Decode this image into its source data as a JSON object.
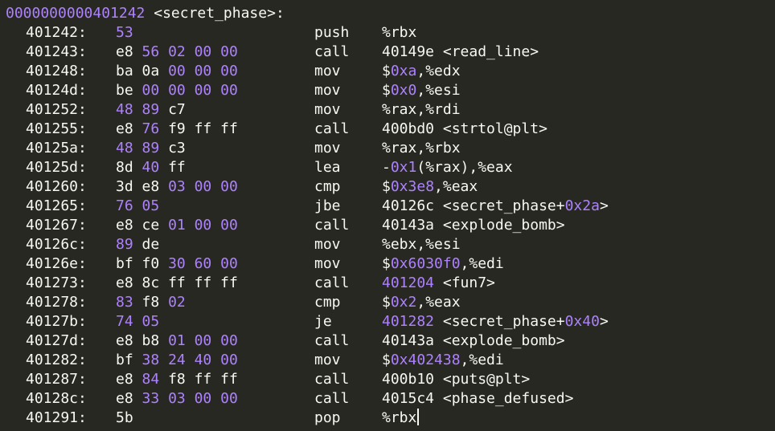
{
  "header": {
    "addr": "0000000000401242",
    "label": " <secret_phase>:"
  },
  "rows": [
    {
      "addr": "401242:",
      "bytes": [
        {
          "t": "53",
          "c": "p"
        }
      ],
      "mnem": "push",
      "ops": [
        {
          "t": "%rbx",
          "c": "w"
        }
      ]
    },
    {
      "addr": "401243:",
      "bytes": [
        {
          "t": "e8",
          "c": "w"
        },
        {
          "t": "56",
          "c": "p"
        },
        {
          "t": "02",
          "c": "p"
        },
        {
          "t": "00",
          "c": "p"
        },
        {
          "t": "00",
          "c": "p"
        }
      ],
      "mnem": "call",
      "ops": [
        {
          "t": "40149e <read_line>",
          "c": "w"
        }
      ]
    },
    {
      "addr": "401248:",
      "bytes": [
        {
          "t": "ba",
          "c": "w"
        },
        {
          "t": "0a",
          "c": "w"
        },
        {
          "t": "00",
          "c": "p"
        },
        {
          "t": "00",
          "c": "p"
        },
        {
          "t": "00",
          "c": "p"
        }
      ],
      "mnem": "mov",
      "ops": [
        {
          "t": "$",
          "c": "w"
        },
        {
          "t": "0xa",
          "c": "p"
        },
        {
          "t": ",%edx",
          "c": "w"
        }
      ]
    },
    {
      "addr": "40124d:",
      "bytes": [
        {
          "t": "be",
          "c": "w"
        },
        {
          "t": "00",
          "c": "p"
        },
        {
          "t": "00",
          "c": "p"
        },
        {
          "t": "00",
          "c": "p"
        },
        {
          "t": "00",
          "c": "p"
        }
      ],
      "mnem": "mov",
      "ops": [
        {
          "t": "$",
          "c": "w"
        },
        {
          "t": "0x0",
          "c": "p"
        },
        {
          "t": ",%esi",
          "c": "w"
        }
      ]
    },
    {
      "addr": "401252:",
      "bytes": [
        {
          "t": "48",
          "c": "p"
        },
        {
          "t": "89",
          "c": "p"
        },
        {
          "t": "c7",
          "c": "w"
        }
      ],
      "mnem": "mov",
      "ops": [
        {
          "t": "%rax,%rdi",
          "c": "w"
        }
      ]
    },
    {
      "addr": "401255:",
      "bytes": [
        {
          "t": "e8",
          "c": "w"
        },
        {
          "t": "76",
          "c": "p"
        },
        {
          "t": "f9",
          "c": "w"
        },
        {
          "t": "ff",
          "c": "w"
        },
        {
          "t": "ff",
          "c": "w"
        }
      ],
      "mnem": "call",
      "ops": [
        {
          "t": "400bd0 <strtol@plt>",
          "c": "w"
        }
      ]
    },
    {
      "addr": "40125a:",
      "bytes": [
        {
          "t": "48",
          "c": "p"
        },
        {
          "t": "89",
          "c": "p"
        },
        {
          "t": "c3",
          "c": "w"
        }
      ],
      "mnem": "mov",
      "ops": [
        {
          "t": "%rax,%rbx",
          "c": "w"
        }
      ]
    },
    {
      "addr": "40125d:",
      "bytes": [
        {
          "t": "8d",
          "c": "w"
        },
        {
          "t": "40",
          "c": "p"
        },
        {
          "t": "ff",
          "c": "w"
        }
      ],
      "mnem": "lea",
      "ops": [
        {
          "t": "-",
          "c": "w"
        },
        {
          "t": "0x1",
          "c": "p"
        },
        {
          "t": "(%rax),%eax",
          "c": "w"
        }
      ]
    },
    {
      "addr": "401260:",
      "bytes": [
        {
          "t": "3d",
          "c": "w"
        },
        {
          "t": "e8",
          "c": "w"
        },
        {
          "t": "03",
          "c": "p"
        },
        {
          "t": "00",
          "c": "p"
        },
        {
          "t": "00",
          "c": "p"
        }
      ],
      "mnem": "cmp",
      "ops": [
        {
          "t": "$",
          "c": "w"
        },
        {
          "t": "0x3e8",
          "c": "p"
        },
        {
          "t": ",%eax",
          "c": "w"
        }
      ]
    },
    {
      "addr": "401265:",
      "bytes": [
        {
          "t": "76",
          "c": "p"
        },
        {
          "t": "05",
          "c": "p"
        }
      ],
      "mnem": "jbe",
      "ops": [
        {
          "t": "40126c <secret_phase+",
          "c": "w"
        },
        {
          "t": "0x2a",
          "c": "p"
        },
        {
          "t": ">",
          "c": "w"
        }
      ]
    },
    {
      "addr": "401267:",
      "bytes": [
        {
          "t": "e8",
          "c": "w"
        },
        {
          "t": "ce",
          "c": "w"
        },
        {
          "t": "01",
          "c": "p"
        },
        {
          "t": "00",
          "c": "p"
        },
        {
          "t": "00",
          "c": "p"
        }
      ],
      "mnem": "call",
      "ops": [
        {
          "t": "40143a <explode_bomb>",
          "c": "w"
        }
      ]
    },
    {
      "addr": "40126c:",
      "bytes": [
        {
          "t": "89",
          "c": "p"
        },
        {
          "t": "de",
          "c": "w"
        }
      ],
      "mnem": "mov",
      "ops": [
        {
          "t": "%ebx,%esi",
          "c": "w"
        }
      ]
    },
    {
      "addr": "40126e:",
      "bytes": [
        {
          "t": "bf",
          "c": "w"
        },
        {
          "t": "f0",
          "c": "w"
        },
        {
          "t": "30",
          "c": "p"
        },
        {
          "t": "60",
          "c": "p"
        },
        {
          "t": "00",
          "c": "p"
        }
      ],
      "mnem": "mov",
      "ops": [
        {
          "t": "$",
          "c": "w"
        },
        {
          "t": "0x6030f0",
          "c": "p"
        },
        {
          "t": ",%edi",
          "c": "w"
        }
      ]
    },
    {
      "addr": "401273:",
      "bytes": [
        {
          "t": "e8",
          "c": "w"
        },
        {
          "t": "8c",
          "c": "w"
        },
        {
          "t": "ff",
          "c": "w"
        },
        {
          "t": "ff",
          "c": "w"
        },
        {
          "t": "ff",
          "c": "w"
        }
      ],
      "mnem": "call",
      "ops": [
        {
          "t": "401204",
          "c": "p"
        },
        {
          "t": " <fun7>",
          "c": "w"
        }
      ]
    },
    {
      "addr": "401278:",
      "bytes": [
        {
          "t": "83",
          "c": "p"
        },
        {
          "t": "f8",
          "c": "w"
        },
        {
          "t": "02",
          "c": "p"
        }
      ],
      "mnem": "cmp",
      "ops": [
        {
          "t": "$",
          "c": "w"
        },
        {
          "t": "0x2",
          "c": "p"
        },
        {
          "t": ",%eax",
          "c": "w"
        }
      ]
    },
    {
      "addr": "40127b:",
      "bytes": [
        {
          "t": "74",
          "c": "p"
        },
        {
          "t": "05",
          "c": "p"
        }
      ],
      "mnem": "je",
      "ops": [
        {
          "t": "401282",
          "c": "p"
        },
        {
          "t": " <secret_phase+",
          "c": "w"
        },
        {
          "t": "0x40",
          "c": "p"
        },
        {
          "t": ">",
          "c": "w"
        }
      ]
    },
    {
      "addr": "40127d:",
      "bytes": [
        {
          "t": "e8",
          "c": "w"
        },
        {
          "t": "b8",
          "c": "w"
        },
        {
          "t": "01",
          "c": "p"
        },
        {
          "t": "00",
          "c": "p"
        },
        {
          "t": "00",
          "c": "p"
        }
      ],
      "mnem": "call",
      "ops": [
        {
          "t": "40143a <explode_bomb>",
          "c": "w"
        }
      ]
    },
    {
      "addr": "401282:",
      "bytes": [
        {
          "t": "bf",
          "c": "w"
        },
        {
          "t": "38",
          "c": "p"
        },
        {
          "t": "24",
          "c": "p"
        },
        {
          "t": "40",
          "c": "p"
        },
        {
          "t": "00",
          "c": "p"
        }
      ],
      "mnem": "mov",
      "ops": [
        {
          "t": "$",
          "c": "w"
        },
        {
          "t": "0x402438",
          "c": "p"
        },
        {
          "t": ",%edi",
          "c": "w"
        }
      ]
    },
    {
      "addr": "401287:",
      "bytes": [
        {
          "t": "e8",
          "c": "w"
        },
        {
          "t": "84",
          "c": "p"
        },
        {
          "t": "f8",
          "c": "w"
        },
        {
          "t": "ff",
          "c": "w"
        },
        {
          "t": "ff",
          "c": "w"
        }
      ],
      "mnem": "call",
      "ops": [
        {
          "t": "400b10 <puts@plt>",
          "c": "w"
        }
      ]
    },
    {
      "addr": "40128c:",
      "bytes": [
        {
          "t": "e8",
          "c": "w"
        },
        {
          "t": "33",
          "c": "p"
        },
        {
          "t": "03",
          "c": "p"
        },
        {
          "t": "00",
          "c": "p"
        },
        {
          "t": "00",
          "c": "p"
        }
      ],
      "mnem": "call",
      "ops": [
        {
          "t": "4015c4 <phase_defused>",
          "c": "w"
        }
      ]
    },
    {
      "addr": "401291:",
      "bytes": [
        {
          "t": "5b",
          "c": "w"
        }
      ],
      "mnem": "pop",
      "ops": [
        {
          "t": "%rbx",
          "c": "w"
        }
      ],
      "caret": true
    }
  ],
  "colors": {
    "background": "#272822",
    "text": "#f8f8f2",
    "number": "#ae81ff"
  }
}
